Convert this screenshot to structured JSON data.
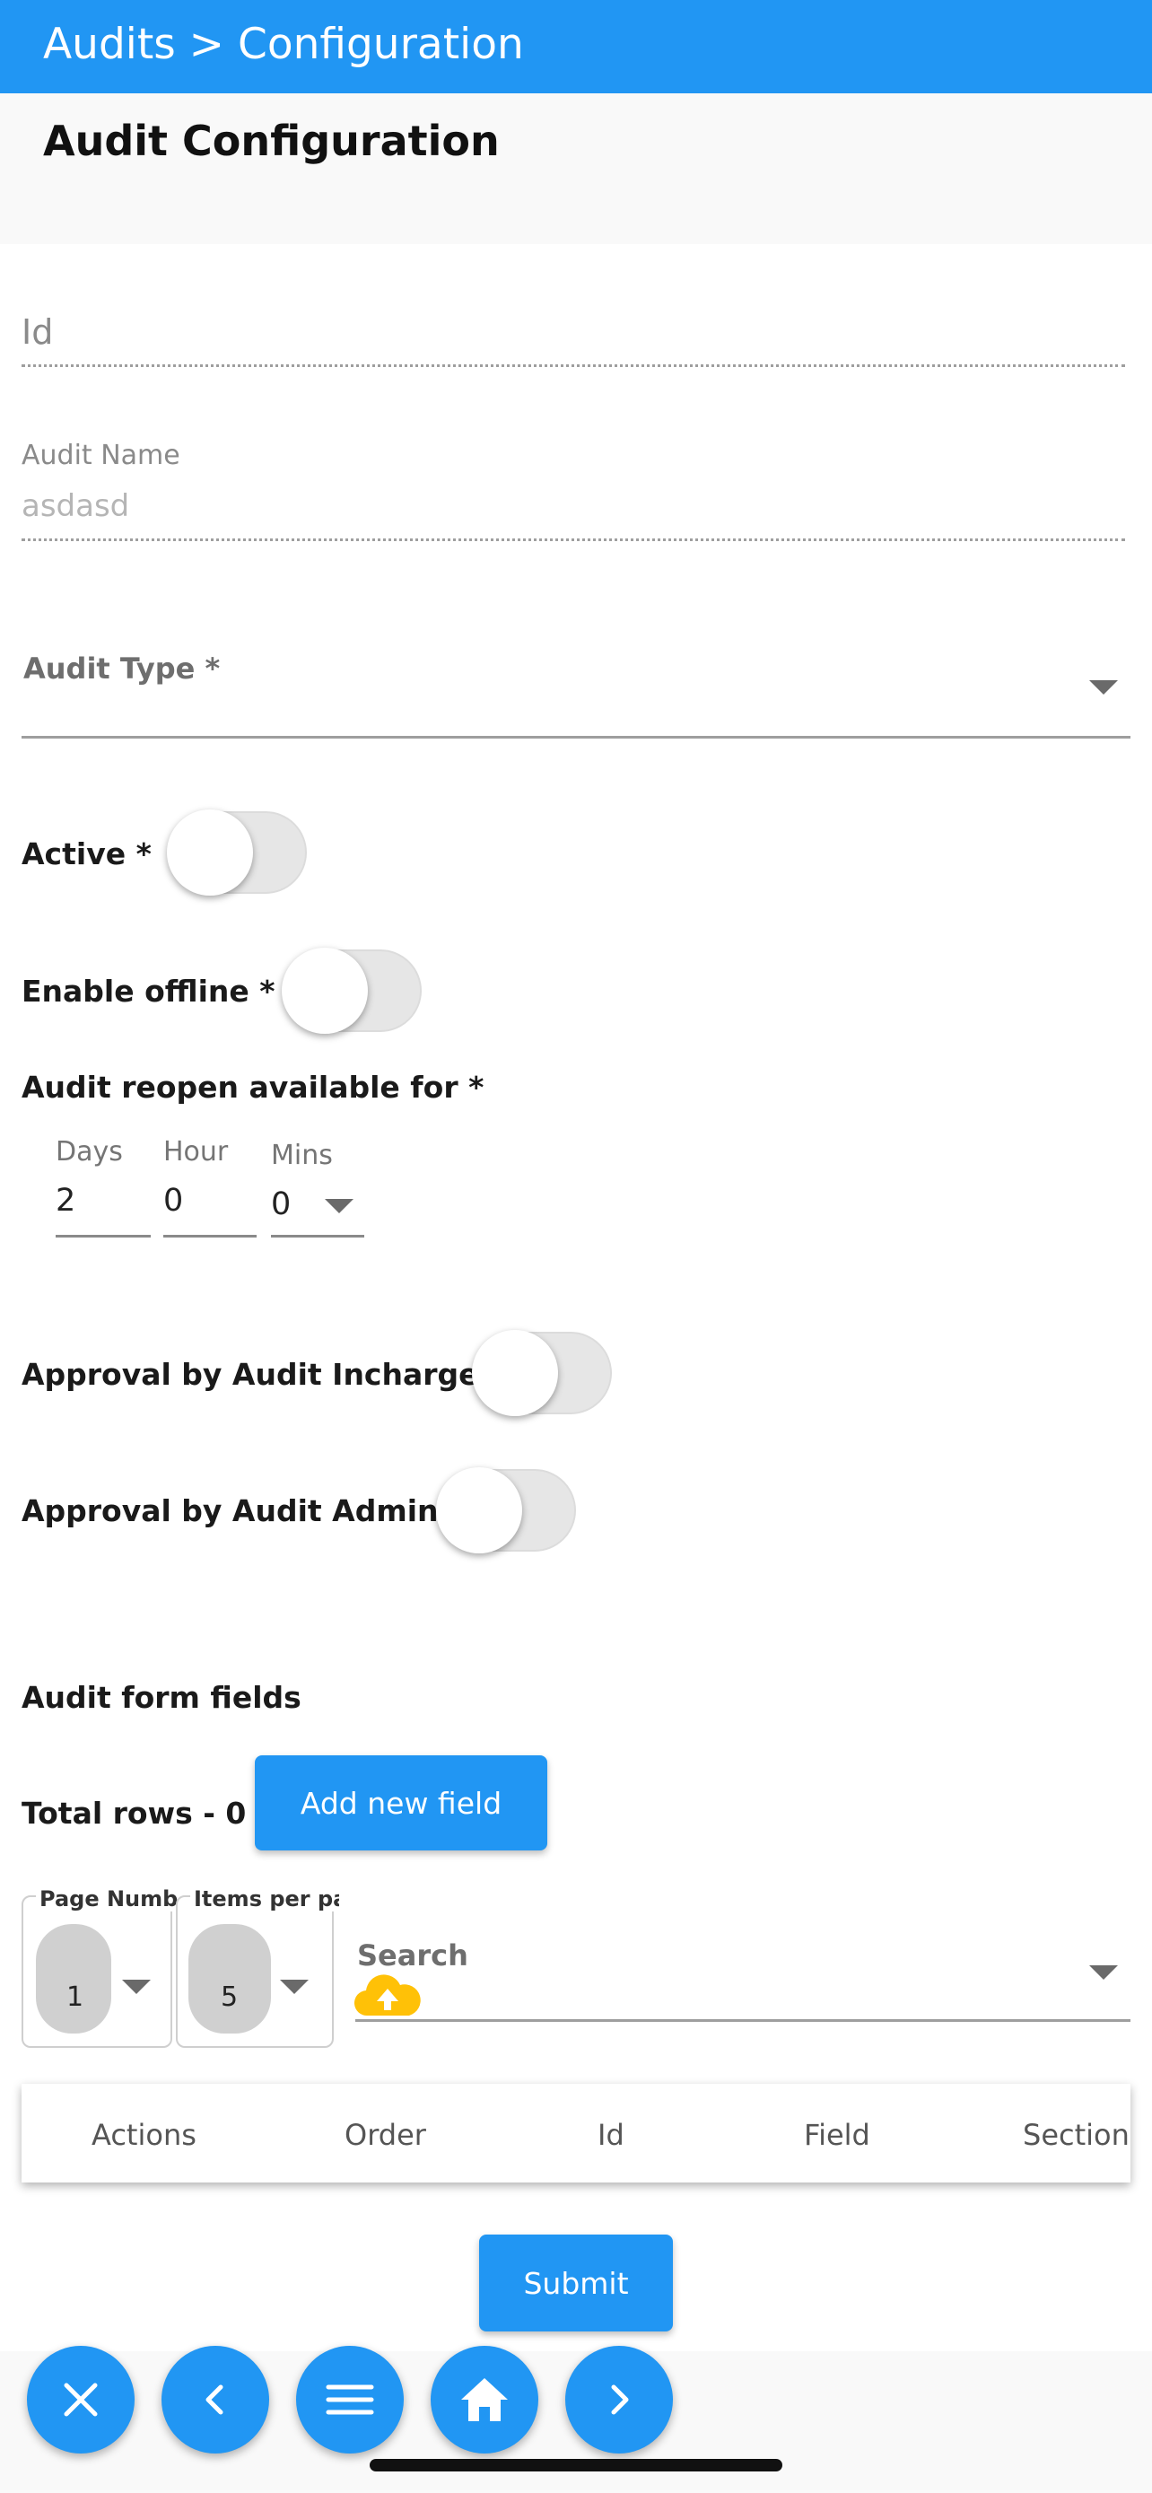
{
  "header": {
    "breadcrumb": "Audits > Configuration"
  },
  "page": {
    "title": "Audit Configuration"
  },
  "form": {
    "id_placeholder": "Id",
    "audit_name_label": "Audit Name",
    "audit_name_value": "asdasd",
    "audit_type_label": "Audit Type *",
    "active_label": "Active *",
    "active_on": false,
    "enable_offline_label": "Enable offline *",
    "enable_offline_on": false,
    "reopen_label": "Audit reopen available for *",
    "days_label": "Days",
    "days_value": "2",
    "hour_label": "Hour",
    "hour_value": "0",
    "mins_label": "Mins",
    "mins_value": "0",
    "approval_incharge_label": "Approval by Audit Incharge",
    "approval_incharge_on": false,
    "approval_admin_label": "Approval by Audit Admin",
    "approval_admin_on": false
  },
  "fields_section": {
    "title": "Audit form fields",
    "total_rows": "Total rows - 0",
    "add_button": "Add new field",
    "page_number_label": "Page Number",
    "page_number_value": "1",
    "items_per_page_label": "Items per page",
    "items_per_page_value": "5",
    "search_label": "Search",
    "columns": [
      "Actions",
      "Order",
      "Id",
      "Field",
      "Section"
    ]
  },
  "submit_label": "Submit",
  "fab_bar": {
    "icons": [
      "close-icon",
      "chevron-left-icon",
      "menu-icon",
      "home-icon",
      "chevron-right-icon"
    ]
  },
  "colors": {
    "primary": "#2196f3",
    "upload_icon": "#ffc107"
  }
}
